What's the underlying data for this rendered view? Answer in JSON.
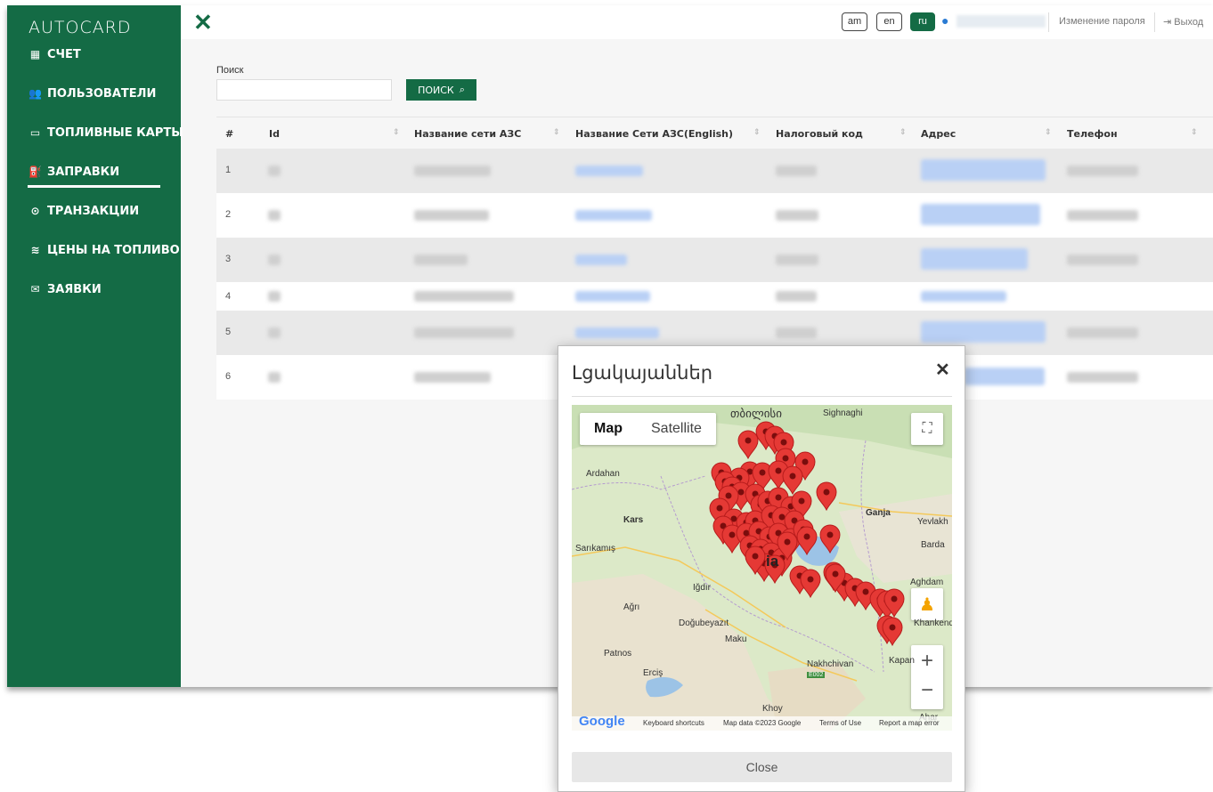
{
  "app": {
    "logo": "AUTOCARD"
  },
  "sidebar": {
    "items": [
      {
        "label": "СЧЕТ",
        "icon": "dashboard-icon"
      },
      {
        "label": "ПОЛЬЗОВАТЕЛИ",
        "icon": "users-icon"
      },
      {
        "label": "ТОПЛИВНЫЕ КАРТЫ",
        "icon": "credit-card-icon"
      },
      {
        "label": "ЗАПРАВКИ",
        "icon": "gas-pump-icon",
        "active": true
      },
      {
        "label": "ТРАНЗАКЦИИ",
        "icon": "transactions-icon"
      },
      {
        "label": "ЦЕНЫ НА ТОПЛИВО",
        "icon": "database-icon"
      },
      {
        "label": "ЗАЯВКИ",
        "icon": "requests-icon"
      }
    ]
  },
  "topbar": {
    "languages": [
      "am",
      "en",
      "ru"
    ],
    "active_language": "ru",
    "change_password": "Изменение пароля",
    "logout": "Выход"
  },
  "search": {
    "label": "Поиск",
    "value": "",
    "button": "ПОИСК"
  },
  "table": {
    "columns": [
      "#",
      "Id",
      "Название сети АЗС",
      "Название Сети АЗС(English)",
      "Налоговый код",
      "Адрес",
      "Телефон"
    ],
    "rows": [
      {
        "num": "1"
      },
      {
        "num": "2"
      },
      {
        "num": "3"
      },
      {
        "num": "4"
      },
      {
        "num": "5"
      },
      {
        "num": "6"
      }
    ]
  },
  "modal": {
    "title": "Լցակայաններ",
    "close_button": "Close",
    "map": {
      "type_map": "Map",
      "type_satellite": "Satellite",
      "labels": [
        "თბილისი",
        "Sighnaghi",
        "Ardahan",
        "Kars",
        "Sarıkamış",
        "Ganja",
        "Yevlakh",
        "Barda",
        "Iğdır",
        "Ağrı",
        "Doğubeyazıt",
        "Maku",
        "Patnos",
        "Erciş",
        "Nakhchivan",
        "Aghdam",
        "Khankendi",
        "Kapan",
        "Khoy",
        "Ahar",
        "ia",
        "E002"
      ],
      "footer": [
        "Keyboard shortcuts",
        "Map data ©2023 Google",
        "Terms of Use",
        "Report a map error"
      ],
      "google": "Google"
    }
  },
  "colors": {
    "brand": "#146b45",
    "marker": "#e53935"
  }
}
